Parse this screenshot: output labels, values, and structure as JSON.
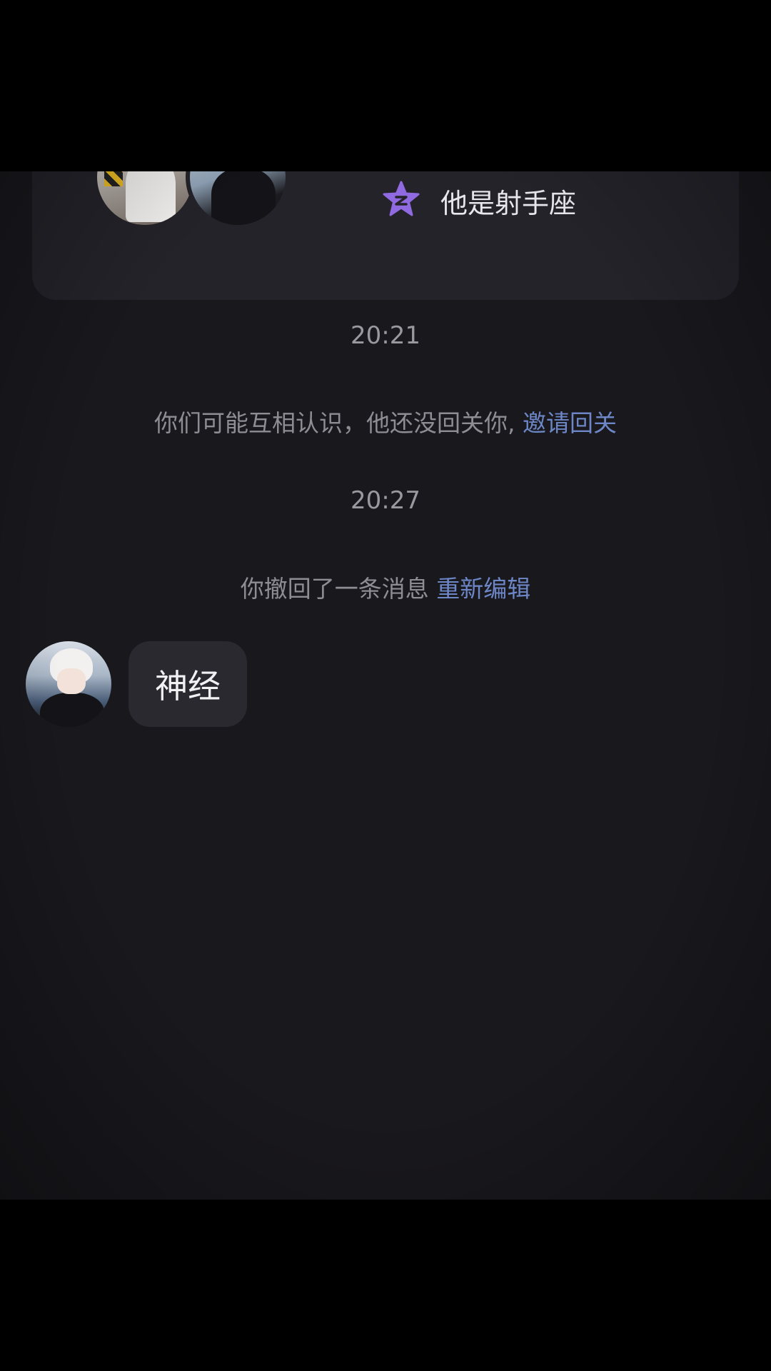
{
  "profile_card": {
    "zodiac_text": "他是射手座",
    "zodiac_icon": "star-icon",
    "accent": "#8f6ae0"
  },
  "messages": {
    "time_1": "20:21",
    "system_1": {
      "text": "你们可能互相认识，他还没回关你, ",
      "link": "邀请回关"
    },
    "time_2": "20:27",
    "system_2": {
      "text": "你撤回了一条消息 ",
      "link": "重新编辑"
    },
    "incoming": {
      "text": "神经"
    }
  },
  "colors": {
    "background": "#19181d",
    "link": "#6c86c6",
    "bubble": "#2a292f"
  }
}
